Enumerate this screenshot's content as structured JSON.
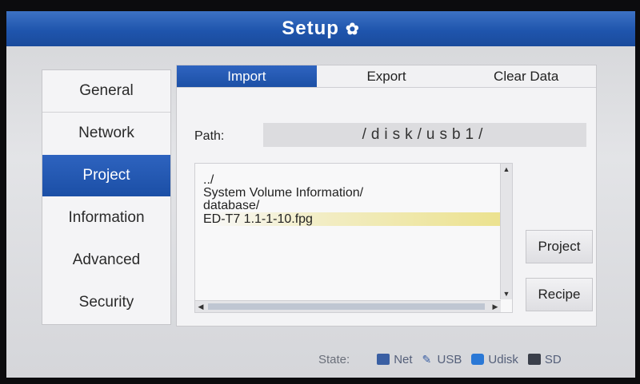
{
  "window": {
    "title": "Setup"
  },
  "sidebar": {
    "items": [
      {
        "label": "General",
        "active": false
      },
      {
        "label": "Network",
        "active": false
      },
      {
        "label": "Project",
        "active": true
      },
      {
        "label": "Information",
        "active": false
      },
      {
        "label": "Advanced",
        "active": false
      },
      {
        "label": "Security",
        "active": false
      }
    ]
  },
  "tabs": [
    {
      "label": "Import",
      "active": true
    },
    {
      "label": "Export",
      "active": false
    },
    {
      "label": "Clear Data",
      "active": false
    }
  ],
  "path": {
    "label": "Path:",
    "value": "/disk/usb1/"
  },
  "files": [
    "../",
    "System Volume Information/",
    "database/",
    "ED-T7 1.1-1-10.fpg"
  ],
  "selected_file_index": 3,
  "buttons": {
    "project": "Project",
    "recipe": "Recipe"
  },
  "status": {
    "label": "State:",
    "items": [
      {
        "name": "net",
        "label": "Net",
        "icon": "network-icon"
      },
      {
        "name": "usb",
        "label": "USB",
        "icon": "usb-icon"
      },
      {
        "name": "udisk",
        "label": "Udisk",
        "icon": "udisk-icon"
      },
      {
        "name": "sd",
        "label": "SD",
        "icon": "sd-card-icon"
      }
    ]
  },
  "colors": {
    "accent": "#1f55ad",
    "selection": "#ece28f"
  }
}
